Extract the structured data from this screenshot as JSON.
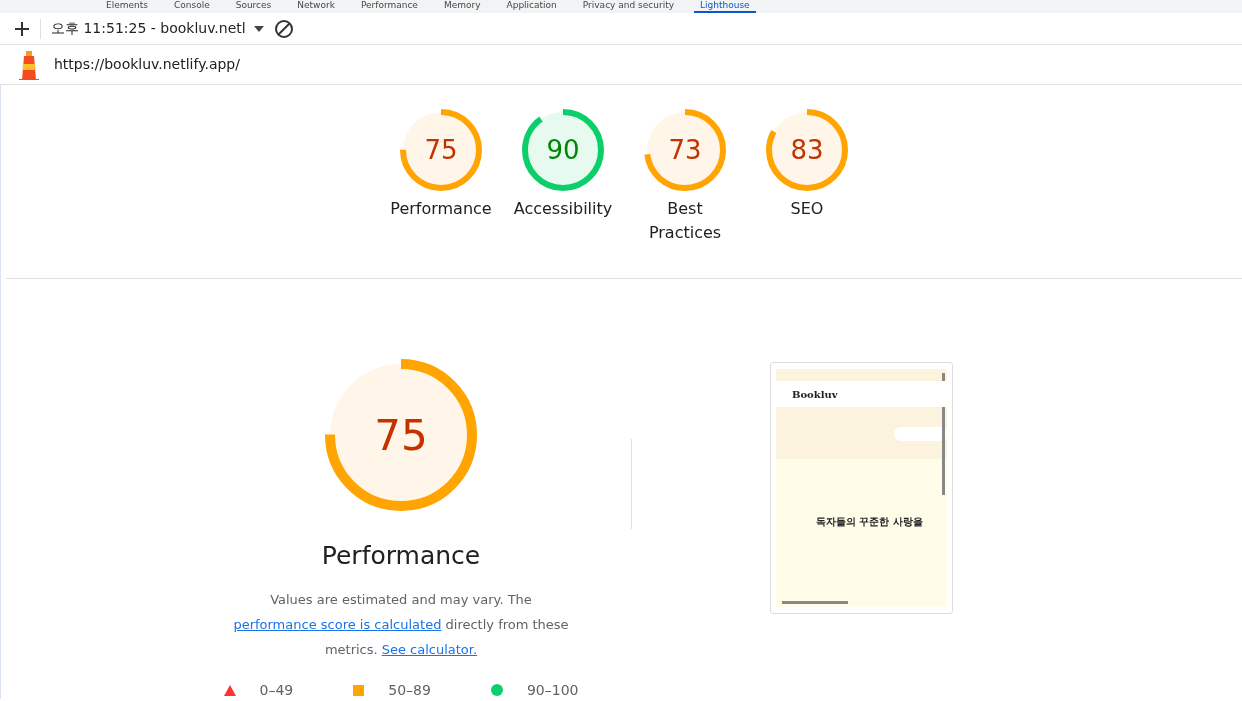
{
  "panel_tabs": [
    {
      "label": "Elements",
      "selected": false
    },
    {
      "label": "Console",
      "selected": false
    },
    {
      "label": "Sources",
      "selected": false
    },
    {
      "label": "Network",
      "selected": false
    },
    {
      "label": "Performance",
      "selected": false
    },
    {
      "label": "Memory",
      "selected": false
    },
    {
      "label": "Application",
      "selected": false
    },
    {
      "label": "Privacy and security",
      "selected": false
    },
    {
      "label": "Lighthouse",
      "selected": true
    }
  ],
  "toolbar": {
    "report_select": "오후 11:51:25 - bookluv.netl"
  },
  "url": "https://bookluv.netlify.app/",
  "gauges": [
    {
      "score": "75",
      "label": "Performance",
      "level": 0.75,
      "kind": "average"
    },
    {
      "score": "90",
      "label": "Accessibility",
      "level": 0.9,
      "kind": "pass"
    },
    {
      "score": "73",
      "label": "Best Practices",
      "level": 0.73,
      "kind": "average"
    },
    {
      "score": "83",
      "label": "SEO",
      "level": 0.83,
      "kind": "average"
    }
  ],
  "main": {
    "score": "75",
    "title": "Performance",
    "level": 0.75,
    "kind": "average",
    "note": "Values are estimated and may vary. The ",
    "note_link": "performance score is calculated",
    "note_after": " directly from these metrics.",
    "calc_link": "See calculator.",
    "legend": [
      {
        "kind": "fail",
        "range": "0–49"
      },
      {
        "kind": "average",
        "range": "50–89"
      },
      {
        "kind": "pass",
        "range": "90–100"
      }
    ],
    "screenshot": {
      "logo": "Bookluv",
      "headline": "독자들의 꾸준한 사랑을"
    }
  }
}
